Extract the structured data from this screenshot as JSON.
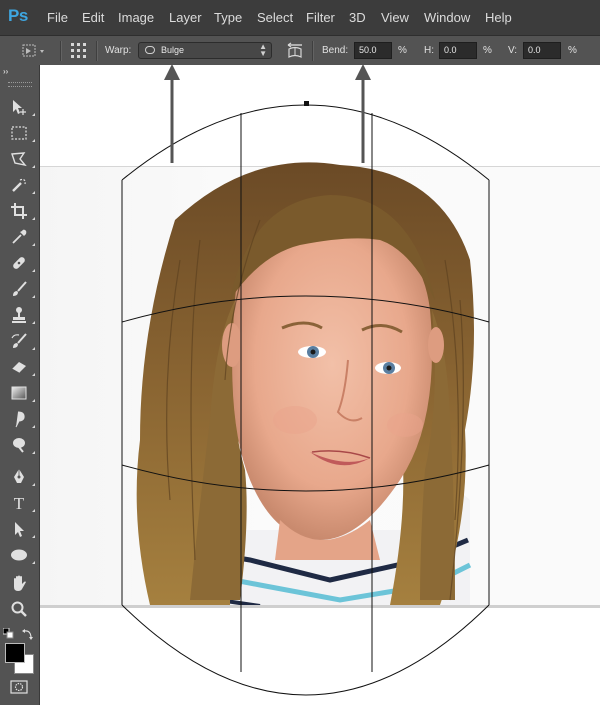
{
  "app": {
    "logo": "Ps",
    "menu": [
      "File",
      "Edit",
      "Image",
      "Layer",
      "Type",
      "Select",
      "Filter",
      "3D",
      "View",
      "Window",
      "Help"
    ]
  },
  "options_bar": {
    "warp_label": "Warp:",
    "warp_value": "Bulge",
    "bend_label": "Bend:",
    "bend_value": "50.0",
    "bend_unit": "%",
    "h_label": "H:",
    "h_value": "0.0",
    "h_unit": "%",
    "v_label": "V:",
    "v_value": "0.0",
    "v_unit": "%"
  },
  "toolbar": {
    "collapse_glyph": "››",
    "tools": [
      {
        "name": "move-tool-icon",
        "glyph": "move"
      },
      {
        "name": "marquee-tool-icon",
        "glyph": "marquee"
      },
      {
        "name": "lasso-tool-icon",
        "glyph": "lasso"
      },
      {
        "name": "quick-selection-tool-icon",
        "glyph": "quicksel"
      },
      {
        "name": "crop-tool-icon",
        "glyph": "crop"
      },
      {
        "name": "eyedropper-tool-icon",
        "glyph": "eyedropper"
      },
      {
        "name": "healing-brush-tool-icon",
        "glyph": "heal"
      },
      {
        "name": "brush-tool-icon",
        "glyph": "brush"
      },
      {
        "name": "clone-stamp-tool-icon",
        "glyph": "stamp"
      },
      {
        "name": "history-brush-tool-icon",
        "glyph": "history"
      },
      {
        "name": "eraser-tool-icon",
        "glyph": "eraser"
      },
      {
        "name": "gradient-tool-icon",
        "glyph": "gradient"
      },
      {
        "name": "blur-tool-icon",
        "glyph": "blur"
      },
      {
        "name": "dodge-tool-icon",
        "glyph": "dodge"
      },
      {
        "name": "pen-tool-icon",
        "glyph": "pen"
      },
      {
        "name": "type-tool-icon",
        "glyph": "T"
      },
      {
        "name": "path-selection-tool-icon",
        "glyph": "pathsel"
      },
      {
        "name": "ellipse-tool-icon",
        "glyph": "ellipse"
      },
      {
        "name": "hand-tool-icon",
        "glyph": "hand"
      },
      {
        "name": "zoom-tool-icon",
        "glyph": "zoom"
      }
    ],
    "foreground_color": "#000000",
    "background_color": "#ffffff"
  },
  "colors": {
    "menubar_bg": "#3c3c3c",
    "panel_bg": "#535353",
    "logo_blue": "#3ea6e0",
    "arrow_gray": "#555555"
  }
}
